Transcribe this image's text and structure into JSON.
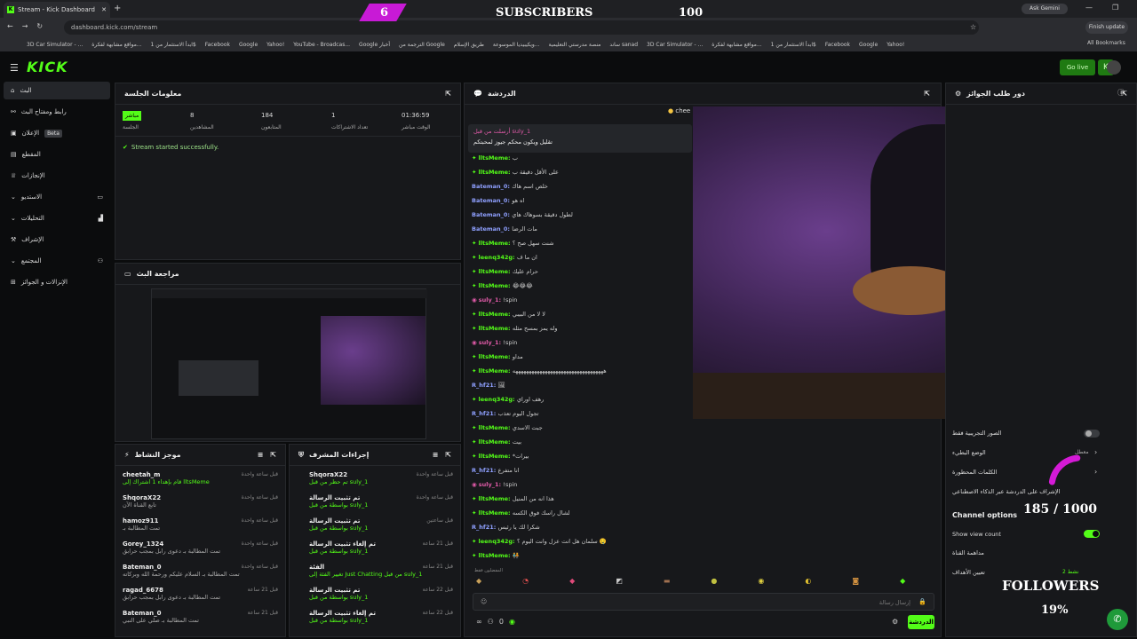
{
  "browser": {
    "tab_title": "Stream - Kick Dashboard",
    "url": "dashboard.kick.com/stream",
    "ask_gemini": "Ask Gemini",
    "finish_update": "Finish update",
    "bookmarks": [
      "3D Car Simulator - ...",
      "مواقع مشابهة لفكرة...",
      "ابدأ الاستثمار من 1$",
      "Facebook",
      "Google",
      "Yahoo!",
      "YouTube - Broadcas...",
      "Google أخبار",
      "الترجمة من Google",
      "طريق الإسلام",
      "ويكيبيديا الموسوعة...",
      "منصة مدرستي التعليمية",
      "ساند sanad",
      "3D Car Simulator - ...",
      "مواقع مشابهة لفكرة...",
      "ابدأ الاستثمار من 1$",
      "Facebook",
      "Google",
      "Yahoo!"
    ],
    "all_bookmarks": "All Bookmarks"
  },
  "overlay": {
    "sub_count": "6",
    "subscribers_label": "SUBSCRIBERS",
    "sub_goal": "100",
    "followers_count": "185 / 1000",
    "followers_label": "FOLLOWERS",
    "followers_percent": "19%",
    "followers_progress": 0.19,
    "subs_progress": 0.06
  },
  "nav": {
    "logo": "KICK",
    "go_live": "Go live"
  },
  "sidebar": {
    "items": [
      {
        "label": "البث",
        "active": true
      },
      {
        "label": "رابط ومفتاح البث"
      },
      {
        "label": "الإعلان",
        "badge": "Beta"
      },
      {
        "label": "المقطع"
      },
      {
        "label": "الإنجازات"
      },
      {
        "label": "الاستديو"
      },
      {
        "label": "التحليلات"
      },
      {
        "label": "الإشراف"
      },
      {
        "label": "المجتمع"
      },
      {
        "label": "الإنزالات و الجوائز"
      }
    ]
  },
  "session": {
    "title": "معلومات الجلسة",
    "live_badge": "مباشر",
    "live_label": "الجلسة",
    "stats": [
      {
        "value": "8",
        "label": "المشاهدين"
      },
      {
        "value": "184",
        "label": "المتابعون"
      },
      {
        "value": "1",
        "label": "تعداد الاشتراكات"
      },
      {
        "value": "01:36:59",
        "label": "الوقت مباشر"
      }
    ],
    "status": "Stream started successfully."
  },
  "preview": {
    "title": "مراجعة البث"
  },
  "activity": {
    "title": "موجز النشاط",
    "rows": [
      {
        "name": "cheetah_m",
        "desc": "قام بإهداء 1 اشتراك إلى lltsMeme",
        "time": "قبل ساعة واحدة"
      },
      {
        "name": "ShqoraX22",
        "desc": "تابع القناة الآن",
        "time": "قبل ساعة واحدة"
      },
      {
        "name": "hamoz911",
        "desc": "تمت المطالبة بـ",
        "time": "قبل ساعة واحدة"
      },
      {
        "name": "Gorey_1324",
        "desc": "تمت المطالبة بـ دعوى رابل بمجب حرابق",
        "time": "قبل ساعة واحدة"
      },
      {
        "name": "Bateman_0",
        "desc": "تمت المطالبة بـ السلام عليكم ورحمة الله وبركاته",
        "time": "قبل ساعة واحدة"
      },
      {
        "name": "ragad_6678",
        "desc": "تمت المطالبة بـ دعوى رابل بمجب حرابق",
        "time": "قبل 21 ساعة"
      },
      {
        "name": "Bateman_0",
        "desc": "تمت المطالبة بـ صلي على النبي",
        "time": "قبل 21 ساعة"
      }
    ]
  },
  "modactions": {
    "title": "إجراءات المشرف",
    "rows": [
      {
        "name": "ShqoraX22",
        "desc": "تم حظر من قبل suly_1",
        "time": "قبل ساعة واحدة"
      },
      {
        "name": "تم تثبيت الرسالة",
        "desc": "بواسطة من قبل suly_1",
        "time": "قبل ساعة واحدة"
      },
      {
        "name": "تم تثبيت الرسالة",
        "desc": "بواسطة من قبل suly_1",
        "time": "قبل ساعتين"
      },
      {
        "name": "تم إلغاء تثبيت الرسالة",
        "desc": "بواسطة من قبل suly_1",
        "time": "قبل 21 ساعة"
      },
      {
        "name": "الفئة",
        "desc": "تغيير الفئة إلى Just Chatting من قبل suly_1",
        "time": "قبل 21 ساعة"
      },
      {
        "name": "تم تثبيت الرسالة",
        "desc": "بواسطة من قبل suly_1",
        "time": "قبل 22 ساعة"
      },
      {
        "name": "تم إلغاء تثبيت الرسالة",
        "desc": "بواسطة من قبل suly_1",
        "time": "قبل 22 ساعة"
      }
    ]
  },
  "chat": {
    "title": "الدردشة",
    "pinned_author": "أرسلت من قبل suly_1",
    "pinned_text": "تقليل ويكون محكم جيوز لمحبتكم",
    "cheer": "chee",
    "messages": [
      {
        "user": "lltsMeme",
        "text": "ب",
        "color": "g"
      },
      {
        "user": "lltsMeme",
        "text": "على الأقل دقيقة ب",
        "color": "g"
      },
      {
        "user": "Bateman_0",
        "text": "خلص اسم هاك",
        "color": "b"
      },
      {
        "user": "Bateman_0",
        "text": "اه هو",
        "color": "b"
      },
      {
        "user": "Bateman_0",
        "text": "لطول دقيقة بسوهاك هاي",
        "color": "b"
      },
      {
        "user": "Bateman_0",
        "text": "مات الرضا",
        "color": "b"
      },
      {
        "user": "lltsMeme",
        "text": "شنت سهل صح ؟",
        "color": "g"
      },
      {
        "user": "leenq342g",
        "text": "ان ما ف",
        "color": "g"
      },
      {
        "user": "lltsMeme",
        "text": "حرام عليك",
        "color": "g"
      },
      {
        "user": "lltsMeme",
        "text": "😂😂😂",
        "color": "g"
      },
      {
        "user": "suly_1",
        "text": "!spin",
        "color": "p"
      },
      {
        "user": "lltsMeme",
        "text": "لا لا من البيبي",
        "color": "g"
      },
      {
        "user": "lltsMeme",
        "text": "وله يمز بمسح مثله",
        "color": "g"
      },
      {
        "user": "suly_1",
        "text": "!spin",
        "color": "p"
      },
      {
        "user": "lltsMeme",
        "text": "مداو",
        "color": "g"
      },
      {
        "user": "lltsMeme",
        "text": "ههههههههههههههههههههههههههههههههههه",
        "color": "g"
      },
      {
        "user": "R_hf21",
        "text": "🖼",
        "color": "b"
      },
      {
        "user": "leenq342g",
        "text": "رهف اوراي",
        "color": "g"
      },
      {
        "user": "R_hf21",
        "text": "تجول اليوم تعذب",
        "color": "b"
      },
      {
        "user": "lltsMeme",
        "text": "جبت الاسدي",
        "color": "g"
      },
      {
        "user": "lltsMeme",
        "text": "بيت",
        "color": "g"
      },
      {
        "user": "lltsMeme",
        "text": "*بيرات",
        "color": "g"
      },
      {
        "user": "R_hf21",
        "text": "انا متفرع",
        "color": "b"
      },
      {
        "user": "suly_1",
        "text": "!spin",
        "color": "p"
      },
      {
        "user": "lltsMeme",
        "text": "هذا انه من المنيل",
        "color": "g"
      },
      {
        "user": "lltsMeme",
        "text": "لشال راسك فوق الكسه",
        "color": "g"
      },
      {
        "user": "R_hf21",
        "text": "شكرا لك يا رئيس",
        "color": "b"
      },
      {
        "user": "leenq342g",
        "text": "سلمان هل انت عزل وانت اليوم ؟ 🤤",
        "color": "g"
      },
      {
        "user": "lltsMeme",
        "text": "🧑‍🤝‍🧑",
        "color": "g"
      }
    ],
    "emote_label": "المفضلون فقط",
    "input_placeholder": "إرسال رسالة",
    "send": "الدردشة",
    "viewer_count": "0"
  },
  "rewards": {
    "title": "دور طلب الجوائز"
  },
  "settings": {
    "items": [
      {
        "label": "الصور التجريبية فقط"
      },
      {
        "label": "الوضع البطيء",
        "value": "معطل"
      },
      {
        "label": "الكلمات المحظورة"
      },
      {
        "label": "الإشراف على الدردشة عبر الذكاء الاصطناعي"
      }
    ],
    "channel_options": "Channel options",
    "show_view_count": "Show view count",
    "stream_label": "مداهمة القناة",
    "goals_label": "تعيين الأهداف",
    "goals_value": "نشط 2"
  }
}
